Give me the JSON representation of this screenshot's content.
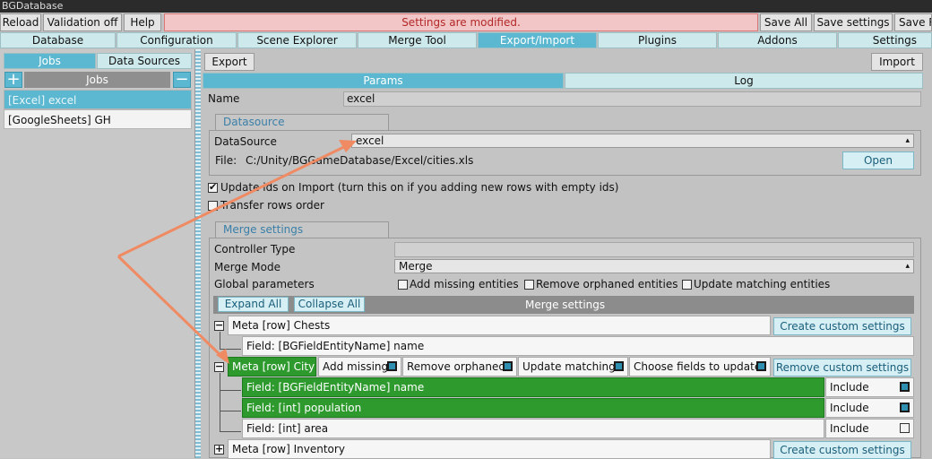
{
  "window": {
    "title": "BGDatabase"
  },
  "toolbar": {
    "reload": "Reload",
    "validation": "Validation off",
    "help": "Help",
    "status": "Settings are modified.",
    "save_all": "Save All",
    "save_settings": "Save settings",
    "save_r": "Save R"
  },
  "tabs": [
    "Database",
    "Configuration",
    "Scene Explorer",
    "Merge Tool",
    "Export/Import",
    "Plugins",
    "Addons",
    "Settings"
  ],
  "left": {
    "tab_jobs": "Jobs",
    "tab_sources": "Data Sources",
    "header": "Jobs",
    "add": "+",
    "remove": "−",
    "items": [
      "[Excel] excel",
      "[GoogleSheets] GH"
    ]
  },
  "main": {
    "export": "Export",
    "import": "Import",
    "tab_params": "Params",
    "tab_log": "Log",
    "name_label": "Name",
    "name_value": "excel",
    "datasource_group": "Datasource",
    "datasource_label": "DataSource",
    "datasource_value": "excel",
    "file_label": "File:",
    "file_value": "C:/Unity/BGGameDatabase/Excel/cities.xls",
    "open": "Open",
    "update_ids": "Update ids on Import (turn this on if you adding new rows with empty ids)",
    "transfer_rows": "Transfer rows order",
    "merge_group": "Merge settings",
    "controller_type": "Controller Type",
    "merge_mode_label": "Merge Mode",
    "merge_mode_value": "Merge",
    "global_params": "Global parameters",
    "add_missing_entities": "Add missing entities",
    "remove_orphaned_entities": "Remove orphaned entities",
    "update_matching_entities": "Update matching entities",
    "expand_all": "Expand All",
    "collapse_all": "Collapse All",
    "merge_settings_header": "Merge settings"
  },
  "tree": {
    "chests": "Meta [row] Chests",
    "chests_field": "Field: [BGFieldEntityName] name",
    "create_custom": "Create custom settings",
    "city": "Meta [row] City",
    "add_missing": "Add missing",
    "remove_orphaned": "Remove orphaned",
    "update_matching": "Update matching",
    "choose_fields": "Choose fields to update",
    "remove_custom": "Remove custom settings",
    "city_fields": [
      {
        "label": "Field: [BGFieldEntityName] name",
        "include": "Include"
      },
      {
        "label": "Field: [int] population",
        "include": "Include"
      },
      {
        "label": "Field: [int] area",
        "include": "Include"
      }
    ],
    "inventory": "Meta [row] Inventory",
    "inventory_create": "Create custom settings"
  },
  "colors": {
    "accent": "#5cb8d0",
    "green": "#2e9a2e",
    "arrow": "#ef8a62",
    "warning": "#b32828"
  }
}
